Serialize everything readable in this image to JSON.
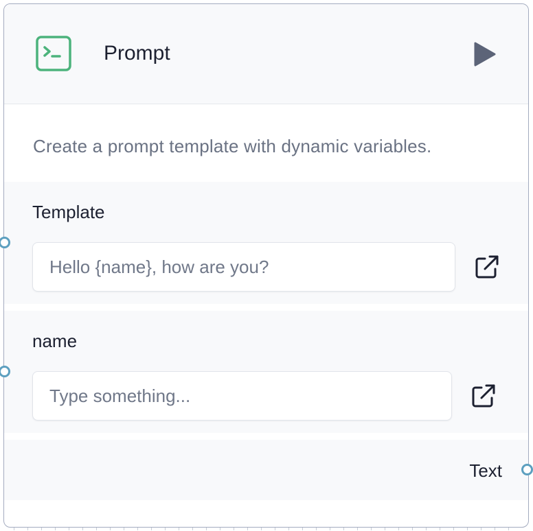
{
  "node": {
    "title": "Prompt",
    "description": "Create a prompt template with dynamic variables.",
    "icon": "terminal-icon",
    "accent_color": "#4cb37c",
    "run_icon": "play-icon"
  },
  "fields": [
    {
      "label": "Template",
      "placeholder": "Hello {name}, how are you?",
      "value": "",
      "expand_icon": "external-link-icon"
    },
    {
      "label": "name",
      "placeholder": "Type something...",
      "value": "",
      "expand_icon": "external-link-icon"
    }
  ],
  "output": {
    "label": "Text"
  },
  "colors": {
    "handle": "#5c9fbf",
    "border": "#a3abbf",
    "section_bg": "#f8f9fb"
  }
}
